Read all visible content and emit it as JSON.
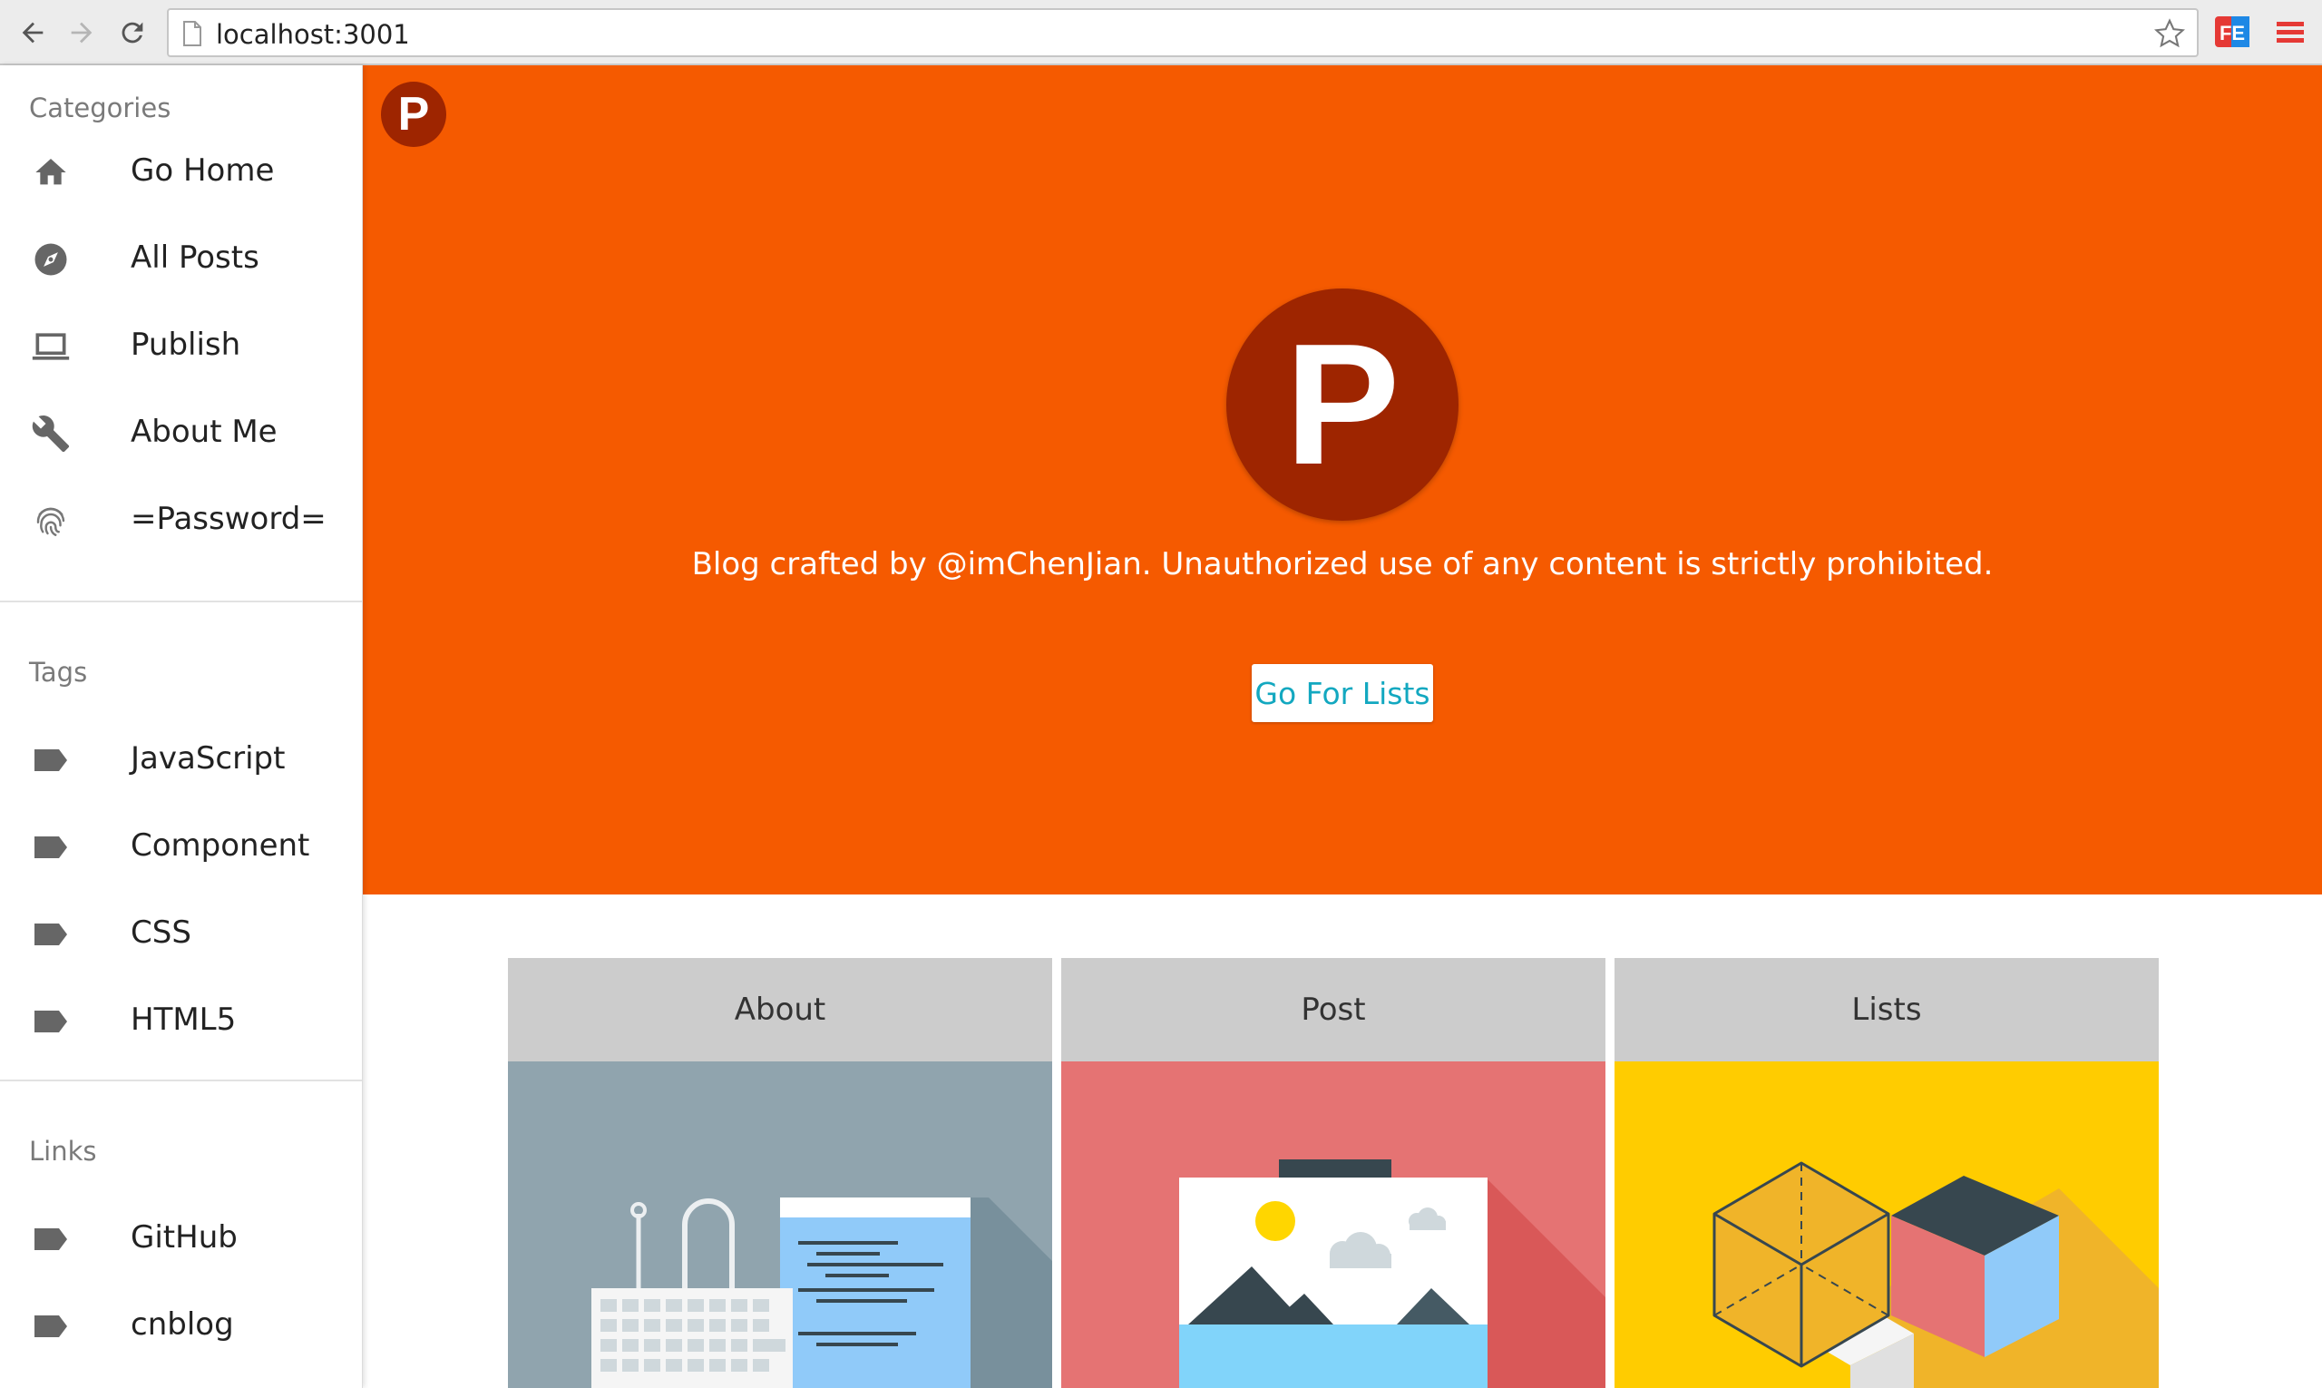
{
  "browser": {
    "url": "localhost:3001",
    "back_icon": "arrow-back-icon",
    "forward_icon": "arrow-forward-icon",
    "reload_icon": "reload-icon",
    "bookmark_icon": "star-outline-icon",
    "extensions": [
      "fe-extension-icon",
      "menu-lines-icon"
    ]
  },
  "sidebar": {
    "categories_title": "Categories",
    "categories": [
      {
        "label": "Go Home",
        "icon": "home-icon"
      },
      {
        "label": "All Posts",
        "icon": "compass-icon"
      },
      {
        "label": "Publish",
        "icon": "laptop-icon"
      },
      {
        "label": "About Me",
        "icon": "wrench-icon"
      },
      {
        "label": "=Password=",
        "icon": "fingerprint-icon"
      }
    ],
    "tags_title": "Tags",
    "tags": [
      {
        "label": "JavaScript",
        "icon": "label-icon"
      },
      {
        "label": "Component",
        "icon": "label-icon"
      },
      {
        "label": "CSS",
        "icon": "label-icon"
      },
      {
        "label": "HTML5",
        "icon": "label-icon"
      }
    ],
    "links_title": "Links",
    "links": [
      {
        "label": "GitHub",
        "icon": "label-icon"
      },
      {
        "label": "cnblog",
        "icon": "label-icon"
      }
    ]
  },
  "hero": {
    "corner_logo_letter": "P",
    "logo_letter": "P",
    "tagline": "Blog crafted by @imChenJian. Unauthorized use of any content is strictly prohibited.",
    "button_label": "Go For Lists",
    "background": "#f55a00",
    "logo_color": "#9e2500",
    "button_text_color": "#13a8c0"
  },
  "cards": [
    {
      "title": "About",
      "art": "desk-keyboard-illustration",
      "color": "#90a4ae"
    },
    {
      "title": "Post",
      "art": "landscape-picture-illustration",
      "color": "#e57373"
    },
    {
      "title": "Lists",
      "art": "cube-illustration",
      "color": "#ffcc00"
    }
  ]
}
